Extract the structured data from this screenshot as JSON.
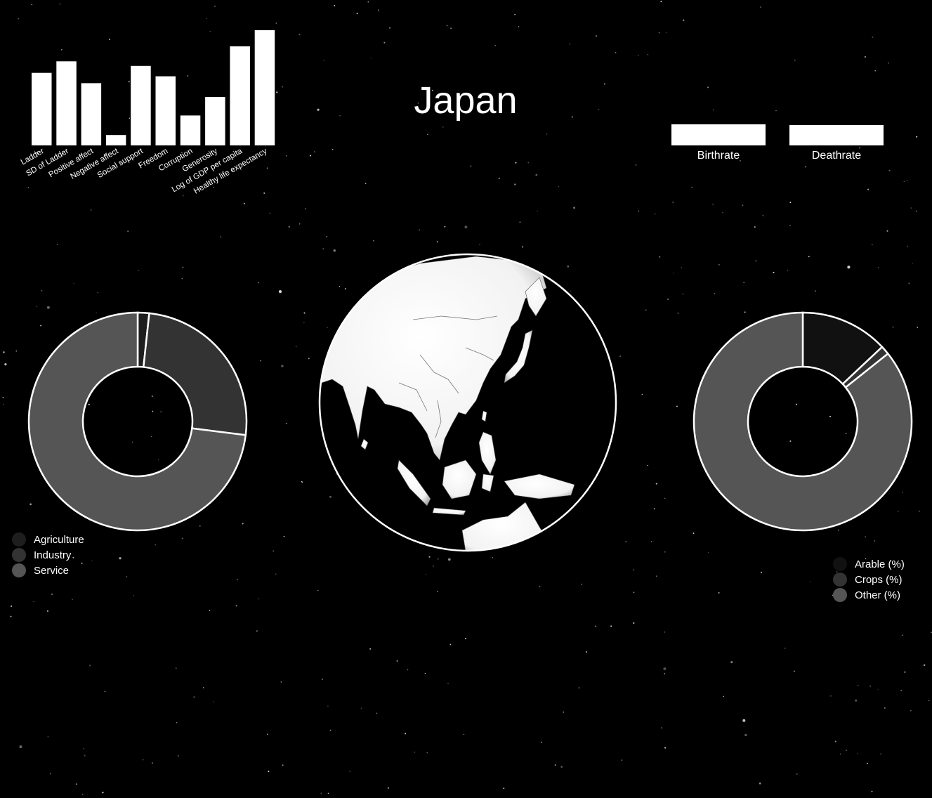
{
  "country": "Japan",
  "colors": {
    "background": "#000000",
    "bar": "#ffffff",
    "agriculture": "#1e1e1e",
    "industry": "#333333",
    "service": "#555555",
    "arable": "#111111",
    "crops": "#333333",
    "other": "#555555",
    "stroke": "#ffffff"
  },
  "rates": {
    "items": [
      {
        "label": "Birthrate"
      },
      {
        "label": "Deathrate"
      }
    ]
  },
  "globe": {
    "description_icon": "globe-icon"
  },
  "chart_data": [
    {
      "type": "bar",
      "categories": [
        "Ladder",
        "SD of Ladder",
        "Positive affect",
        "Negative affect",
        "Social support",
        "Freedom",
        "Corruption",
        "Generosity",
        "Log of GDP per capita",
        "Healthy life expectancy"
      ],
      "values": [
        0.63,
        0.73,
        0.54,
        0.09,
        0.69,
        0.6,
        0.26,
        0.42,
        0.86,
        1.0
      ],
      "ylim": [
        0,
        1
      ],
      "grid": false
    },
    {
      "type": "pie",
      "categories": [
        "Agriculture",
        "Industry",
        "Service"
      ],
      "values": [
        1.7,
        25.3,
        73.0
      ],
      "legend_position": "bottom-left"
    },
    {
      "type": "pie",
      "categories": [
        "Arable (%)",
        "Crops (%)",
        "Other (%)"
      ],
      "values": [
        13.0,
        1.3,
        85.7
      ],
      "legend_position": "bottom-right"
    }
  ]
}
